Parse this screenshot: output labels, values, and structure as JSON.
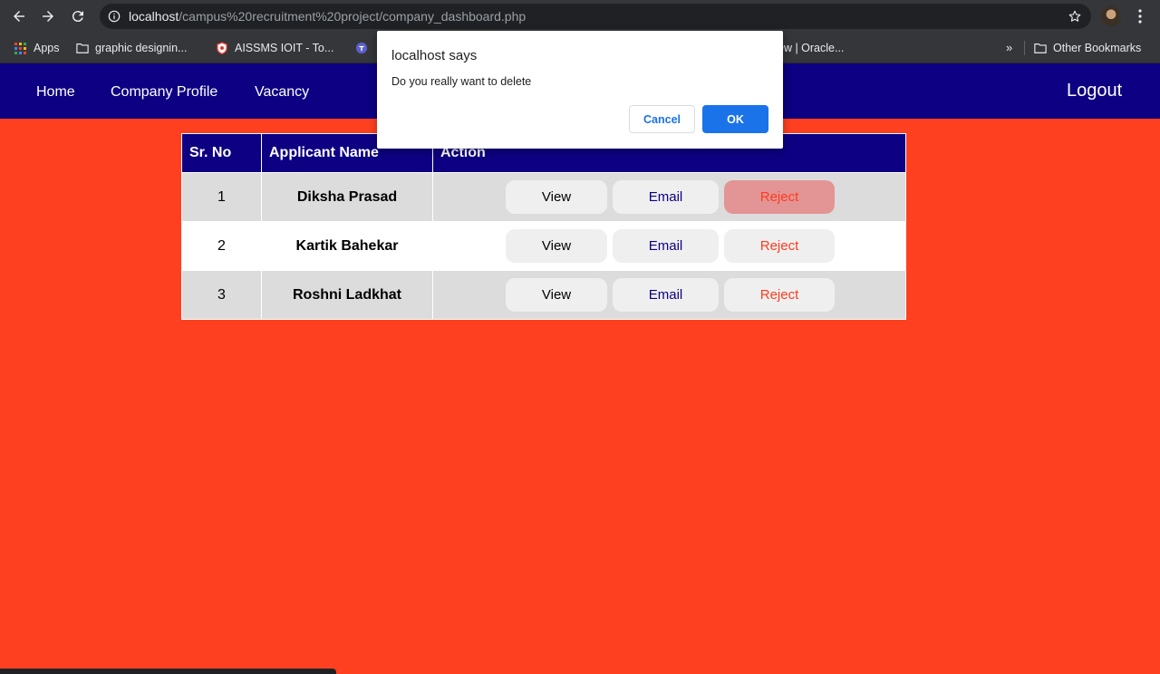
{
  "browser": {
    "url_host": "localhost",
    "url_path": "/campus%20recruitment%20project/company_dashboard.php",
    "bookmarks": [
      {
        "label": "Apps"
      },
      {
        "label": "graphic designin..."
      },
      {
        "label": "AISSMS IOIT - To..."
      },
      {
        "label": "ew | Oracle..."
      },
      {
        "label": "Other Bookmarks"
      }
    ],
    "overflow_chevron": "»"
  },
  "nav": {
    "home": "Home",
    "company_profile": "Company Profile",
    "vacancy": "Vacancy",
    "logout": "Logout"
  },
  "table": {
    "headers": [
      "Sr. No",
      "Applicant Name",
      "Action"
    ],
    "rows": [
      {
        "sr": "1",
        "name": "Diksha Prasad"
      },
      {
        "sr": "2",
        "name": "Kartik Bahekar"
      },
      {
        "sr": "3",
        "name": "Roshni Ladkhat"
      }
    ],
    "actions": {
      "view": "View",
      "email": "Email",
      "reject": "Reject"
    }
  },
  "dialog": {
    "title": "localhost says",
    "message": "Do you really want to delete",
    "cancel": "Cancel",
    "ok": "OK"
  },
  "colors": {
    "page_background": "#ff4020",
    "nav_background": "#0d0082",
    "reject_text": "#ff3b1f",
    "dialog_ok": "#1a73e8"
  }
}
